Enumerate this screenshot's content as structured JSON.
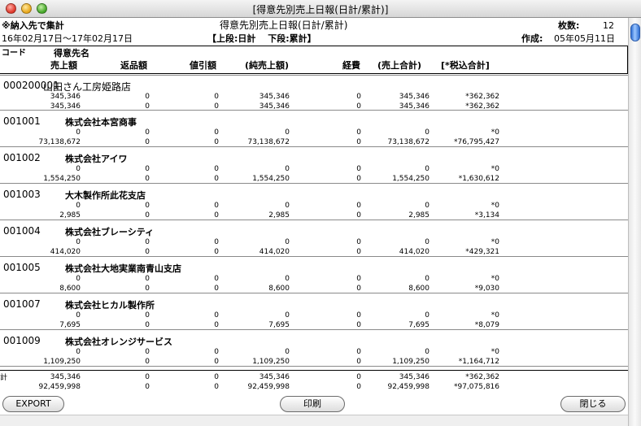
{
  "window": {
    "title": "[得意先別売上日報(日計/累計)]"
  },
  "header": {
    "note": "※納入先で集計",
    "report_title": "得意先別売上日報(日計/累計)",
    "pages_label": "枚数:",
    "pages_value": "12",
    "period": "16年02月17日～17年02月17日",
    "legend": "【上段:日計　 下段:累計】",
    "created_label": "作成:",
    "created_value": "05年05月11日"
  },
  "columns": {
    "code": "コード",
    "name": "得意先名",
    "sales": "売上額",
    "returns": "返品額",
    "discount": "値引額",
    "net_sales": "(純売上額)",
    "expense": "経費",
    "sales_total": "(売上合計)",
    "tax_total": "[*税込合計]"
  },
  "customers": [
    {
      "code": "000200001",
      "name": "山田さん工房姫路店",
      "daily": [
        "345,346",
        "0",
        "0",
        "345,346",
        "0",
        "345,346",
        "*362,362"
      ],
      "cumulative": [
        "345,346",
        "0",
        "0",
        "345,346",
        "0",
        "345,346",
        "*362,362"
      ]
    },
    {
      "code": "001001",
      "name": "株式会社本宮商事",
      "daily": [
        "0",
        "0",
        "0",
        "0",
        "0",
        "0",
        "*0"
      ],
      "cumulative": [
        "73,138,672",
        "0",
        "0",
        "73,138,672",
        "0",
        "73,138,672",
        "*76,795,427"
      ]
    },
    {
      "code": "001002",
      "name": "株式会社アイワ",
      "daily": [
        "0",
        "0",
        "0",
        "0",
        "0",
        "0",
        "*0"
      ],
      "cumulative": [
        "1,554,250",
        "0",
        "0",
        "1,554,250",
        "0",
        "1,554,250",
        "*1,630,612"
      ]
    },
    {
      "code": "001003",
      "name": "大木製作所此花支店",
      "daily": [
        "0",
        "0",
        "0",
        "0",
        "0",
        "0",
        "*0"
      ],
      "cumulative": [
        "2,985",
        "0",
        "0",
        "2,985",
        "0",
        "2,985",
        "*3,134"
      ]
    },
    {
      "code": "001004",
      "name": "株式会社ブレーシティ",
      "daily": [
        "0",
        "0",
        "0",
        "0",
        "0",
        "0",
        "*0"
      ],
      "cumulative": [
        "414,020",
        "0",
        "0",
        "414,020",
        "0",
        "414,020",
        "*429,321"
      ]
    },
    {
      "code": "001005",
      "name": "株式会社大地実業南青山支店",
      "daily": [
        "0",
        "0",
        "0",
        "0",
        "0",
        "0",
        "*0"
      ],
      "cumulative": [
        "8,600",
        "0",
        "0",
        "8,600",
        "0",
        "8,600",
        "*9,030"
      ]
    },
    {
      "code": "001007",
      "name": "株式会社ヒカル製作所",
      "daily": [
        "0",
        "0",
        "0",
        "0",
        "0",
        "0",
        "*0"
      ],
      "cumulative": [
        "7,695",
        "0",
        "0",
        "7,695",
        "0",
        "7,695",
        "*8,079"
      ]
    },
    {
      "code": "001009",
      "name": "株式会社オレンジサービス",
      "daily": [
        "0",
        "0",
        "0",
        "0",
        "0",
        "0",
        "*0"
      ],
      "cumulative": [
        "1,109,250",
        "0",
        "0",
        "1,109,250",
        "0",
        "1,109,250",
        "*1,164,712"
      ]
    }
  ],
  "totals": {
    "label": "計",
    "daily": [
      "345,346",
      "0",
      "0",
      "345,346",
      "0",
      "345,346",
      "*362,362"
    ],
    "cumulative": [
      "92,459,998",
      "0",
      "0",
      "92,459,998",
      "0",
      "92,459,998",
      "*97,075,816"
    ]
  },
  "buttons": {
    "export": "EXPORT",
    "print": "印刷",
    "close": "閉じる"
  }
}
